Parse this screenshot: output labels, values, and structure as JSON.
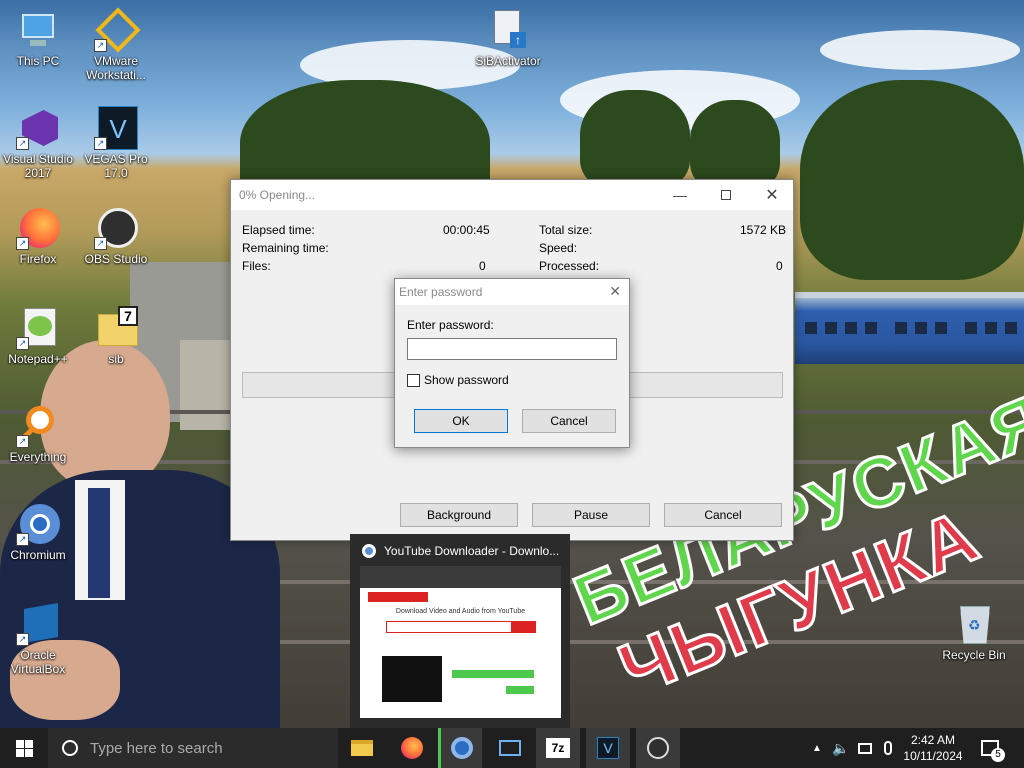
{
  "desktop": {
    "icons": [
      {
        "label": "This PC"
      },
      {
        "label": "VMware Workstati..."
      },
      {
        "label": "SiBActivator"
      },
      {
        "label": "Visual Studio 2017"
      },
      {
        "label": "VEGAS Pro 17.0"
      },
      {
        "label": "Firefox"
      },
      {
        "label": "OBS Studio"
      },
      {
        "label": "Notepad++"
      },
      {
        "label": "sib"
      },
      {
        "label": "Everything"
      },
      {
        "label": "Chromium"
      },
      {
        "label": "Oracle VirtualBox"
      },
      {
        "label": "Recycle Bin"
      }
    ],
    "wallpaper_text": [
      "БЕЛАРУСКАЯ",
      "ЧЫГУНКА"
    ]
  },
  "progress_window": {
    "title": "0% Opening...",
    "elapsed_label": "Elapsed time:",
    "elapsed_value": "00:00:45",
    "remaining_label": "Remaining time:",
    "files_label": "Files:",
    "files_value": "0",
    "total_size_label": "Total size:",
    "total_size_value": "1572 KB",
    "speed_label": "Speed:",
    "processed_label": "Processed:",
    "processed_value": "0",
    "buttons": {
      "background": "Background",
      "pause": "Pause",
      "cancel": "Cancel"
    }
  },
  "password_dialog": {
    "title": "Enter password",
    "prompt": "Enter password:",
    "password_value": "",
    "show_password_label": "Show password",
    "show_password_checked": false,
    "ok_label": "OK",
    "cancel_label": "Cancel"
  },
  "taskbar_preview": {
    "title": "YouTube Downloader - Downlo...",
    "page_heading": "Download Video and Audio from YouTube"
  },
  "taskbar": {
    "search_placeholder": "Type here to search",
    "time": "2:42 AM",
    "date": "10/11/2024",
    "notification_count": "5",
    "pinned": [
      "File Explorer",
      "Firefox",
      "Chromium",
      "Windows Sandbox",
      "7-Zip",
      "VEGAS Pro",
      "OBS Studio"
    ]
  },
  "colors": {
    "taskbar": "#1f1f1f",
    "accent": "#0078d7",
    "active_indicator": "#4ec94e"
  }
}
